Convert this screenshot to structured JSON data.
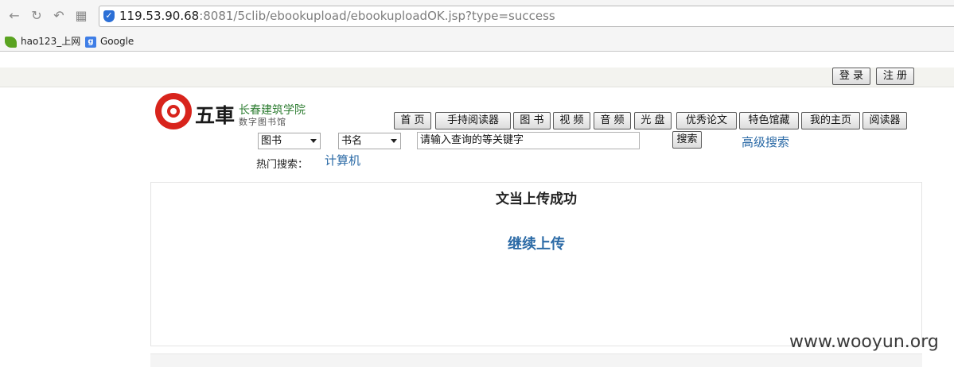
{
  "browser": {
    "url_host": "119.53.90.68",
    "url_rest": ":8081/5clib/ebookupload/ebookuploadOK.jsp?type=success",
    "bookmarks": [
      {
        "label": "hao123_上网",
        "icon": "hao123-icon"
      },
      {
        "label": "Google",
        "icon": "google-icon"
      }
    ]
  },
  "header": {
    "login": "登 录",
    "register": "注 册"
  },
  "logo": {
    "glyph": "五車",
    "name": "长春建筑学院",
    "subtitle": "数字图书馆"
  },
  "nav": {
    "home": "首 页",
    "reader_app": "手持阅读器",
    "books": "图 书",
    "video": "视 频",
    "audio": "音 频",
    "disc": "光 盘",
    "theses": "优秀论文",
    "special": "特色馆藏",
    "my_page": "我的主页",
    "reader": "阅读器"
  },
  "search": {
    "category": "图书",
    "field": "书名",
    "input_value": "请输入查询的等关键字",
    "button": "搜索",
    "advanced": "高级搜索",
    "hot_label": "热门搜索：",
    "hot_term": "计算机"
  },
  "result": {
    "message": "文当上传成功",
    "continue_link": "继续上传"
  },
  "watermark": "www.wooyun.org"
}
